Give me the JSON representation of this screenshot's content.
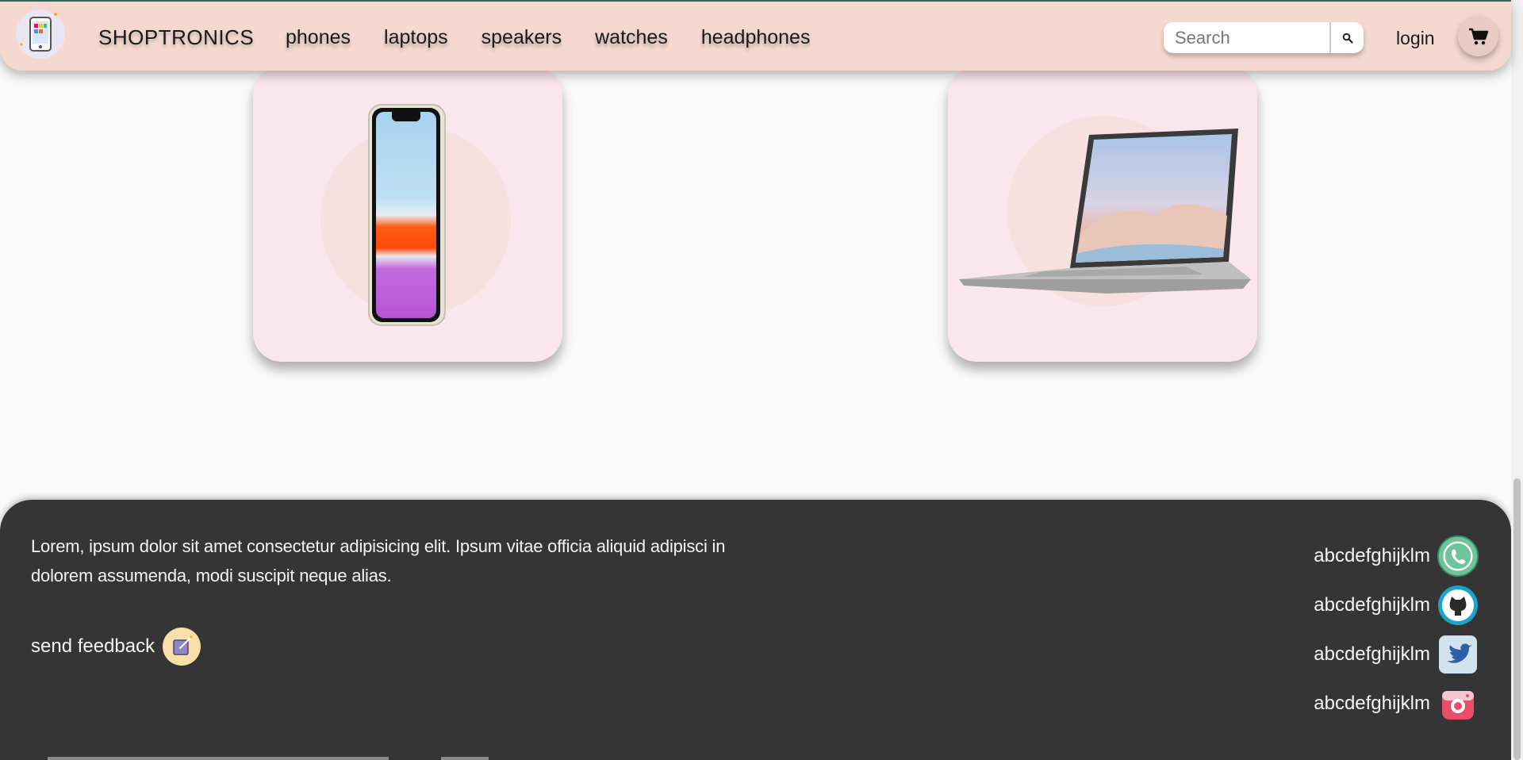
{
  "navbar": {
    "brand": "SHOPTRONICS",
    "links": [
      "phones",
      "laptops",
      "speakers",
      "watches",
      "headphones"
    ],
    "search_placeholder": "Search",
    "login": "login",
    "icons": {
      "logo": "phone-logo-icon",
      "search": "search-icon",
      "cart": "cart-icon"
    },
    "colors": {
      "background": "#f5d9d1"
    }
  },
  "products": [
    {
      "name": "phone",
      "icon": "smartphone-image"
    },
    {
      "name": "laptop",
      "icon": "laptop-image"
    }
  ],
  "footer": {
    "text": "Lorem, ipsum dolor sit amet consectetur adipisicing elit. Ipsum vitae officia aliquid adipisci in dolorem assumenda, modi suscipit neque alias.",
    "feedback_label": "send feedback",
    "socials": [
      {
        "label": "abcdefghijklm",
        "icon": "whatsapp-icon"
      },
      {
        "label": "abcdefghijklm",
        "icon": "github-icon"
      },
      {
        "label": "abcdefghijklm",
        "icon": "twitter-icon"
      },
      {
        "label": "abcdefghijklm",
        "icon": "instagram-icon"
      }
    ],
    "colors": {
      "background": "#353535"
    }
  }
}
